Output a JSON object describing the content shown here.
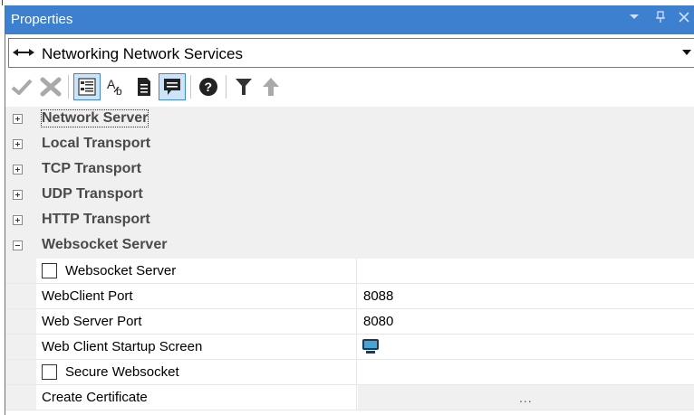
{
  "window": {
    "title": "Properties",
    "title_controls": [
      "dropdown-icon",
      "pin-icon",
      "close-icon"
    ]
  },
  "selector": {
    "icon": "bidirectional-arrows-icon",
    "value": "Networking Network Services"
  },
  "toolbar": {
    "tools": [
      {
        "name": "apply-check-icon",
        "active": false
      },
      {
        "name": "discard-x-icon",
        "active": false
      },
      {
        "name": "categorized-view-icon",
        "active": true
      },
      {
        "name": "alphabetical-sort-icon",
        "active": false
      },
      {
        "name": "property-pages-icon",
        "active": false
      },
      {
        "name": "description-comment-icon",
        "active": true
      },
      {
        "name": "help-icon",
        "active": false
      },
      {
        "name": "filter-icon",
        "active": false
      },
      {
        "name": "up-arrow-icon",
        "active": false
      }
    ]
  },
  "categories": [
    {
      "label": "Network Server",
      "expanded": false
    },
    {
      "label": "Local Transport",
      "expanded": false
    },
    {
      "label": "TCP Transport",
      "expanded": false
    },
    {
      "label": "UDP Transport",
      "expanded": false
    },
    {
      "label": "HTTP Transport",
      "expanded": false
    },
    {
      "label": "Websocket Server",
      "expanded": true
    }
  ],
  "properties": [
    {
      "name": "Websocket Server",
      "type": "checkbox",
      "checked": false,
      "value": ""
    },
    {
      "name": "WebClient Port",
      "type": "text",
      "value": "8088"
    },
    {
      "name": "Web Server Port",
      "type": "text",
      "value": "8080"
    },
    {
      "name": "Web Client Startup Screen",
      "type": "icon",
      "value_icon": "monitor-screen-icon"
    },
    {
      "name": "Secure Websocket",
      "type": "checkbox",
      "checked": false,
      "value": ""
    },
    {
      "name": "Create Certificate",
      "type": "button",
      "value": "..."
    }
  ],
  "colors": {
    "titlebar": "#3d80d0",
    "accent": "#3f86d4",
    "category_text": "#4a4a4a",
    "gutter": "#f0f0f0"
  }
}
